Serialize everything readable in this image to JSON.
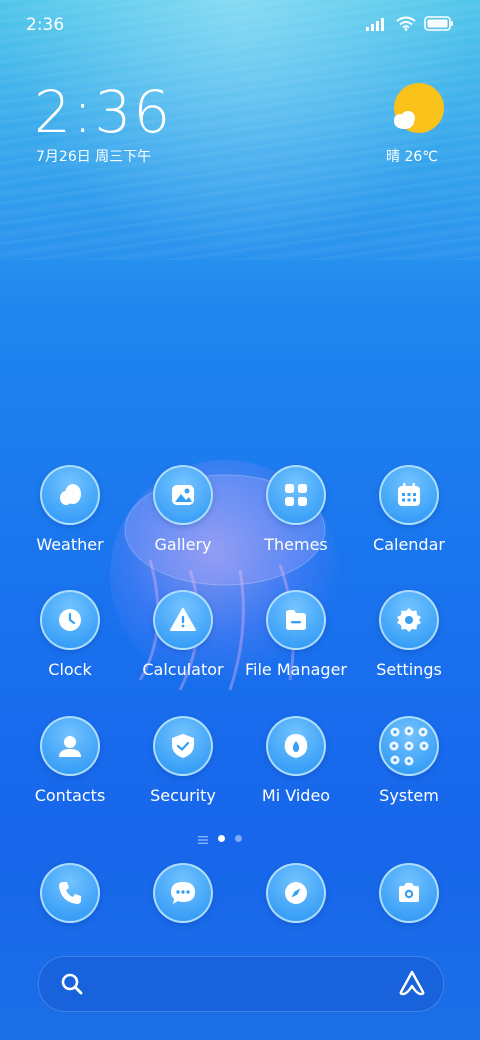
{
  "status_bar": {
    "time": "2:36"
  },
  "clock_widget": {
    "time": "2:36",
    "date": "7月26日 周三下午"
  },
  "weather_widget": {
    "text": "晴 26℃",
    "icon": "sun-cloud-icon"
  },
  "apps": [
    {
      "label": "Weather",
      "icon": "weather-icon"
    },
    {
      "label": "Gallery",
      "icon": "gallery-icon"
    },
    {
      "label": "Themes",
      "icon": "themes-icon"
    },
    {
      "label": "Calendar",
      "icon": "calendar-icon"
    },
    {
      "label": "Clock",
      "icon": "clock-icon"
    },
    {
      "label": "Calculator",
      "icon": "calculator-icon"
    },
    {
      "label": "File Manager",
      "icon": "folder-icon"
    },
    {
      "label": "Settings",
      "icon": "gear-icon"
    },
    {
      "label": "Contacts",
      "icon": "contacts-icon"
    },
    {
      "label": "Security",
      "icon": "shield-icon"
    },
    {
      "label": "Mi Video",
      "icon": "video-icon"
    },
    {
      "label": "System",
      "icon": "folder-grid-icon"
    }
  ],
  "page_indicator": {
    "pages": 2,
    "current": 1
  },
  "dock": [
    {
      "icon": "phone-icon"
    },
    {
      "icon": "messages-icon"
    },
    {
      "icon": "browser-icon"
    },
    {
      "icon": "camera-icon"
    }
  ],
  "search_bar": {
    "left_icon": "search-icon",
    "right_icon": "assistant-icon"
  },
  "colors": {
    "accent": "#1a74ee",
    "sun": "#f8c21a"
  }
}
